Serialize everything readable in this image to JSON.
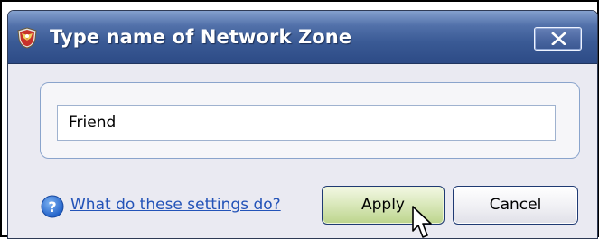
{
  "window": {
    "title": "Type name of Network Zone",
    "close_icon": "close-icon",
    "app_icon": "shield-icon"
  },
  "form": {
    "zone_name_value": "Friend"
  },
  "footer": {
    "help_link_label": "What do these settings do?",
    "help_icon": "question-mark-icon",
    "apply_label": "Apply",
    "cancel_label": "Cancel"
  },
  "colors": {
    "titlebar": "#3a5a95",
    "link": "#2353b8",
    "apply_button": "#dbe9bd"
  }
}
